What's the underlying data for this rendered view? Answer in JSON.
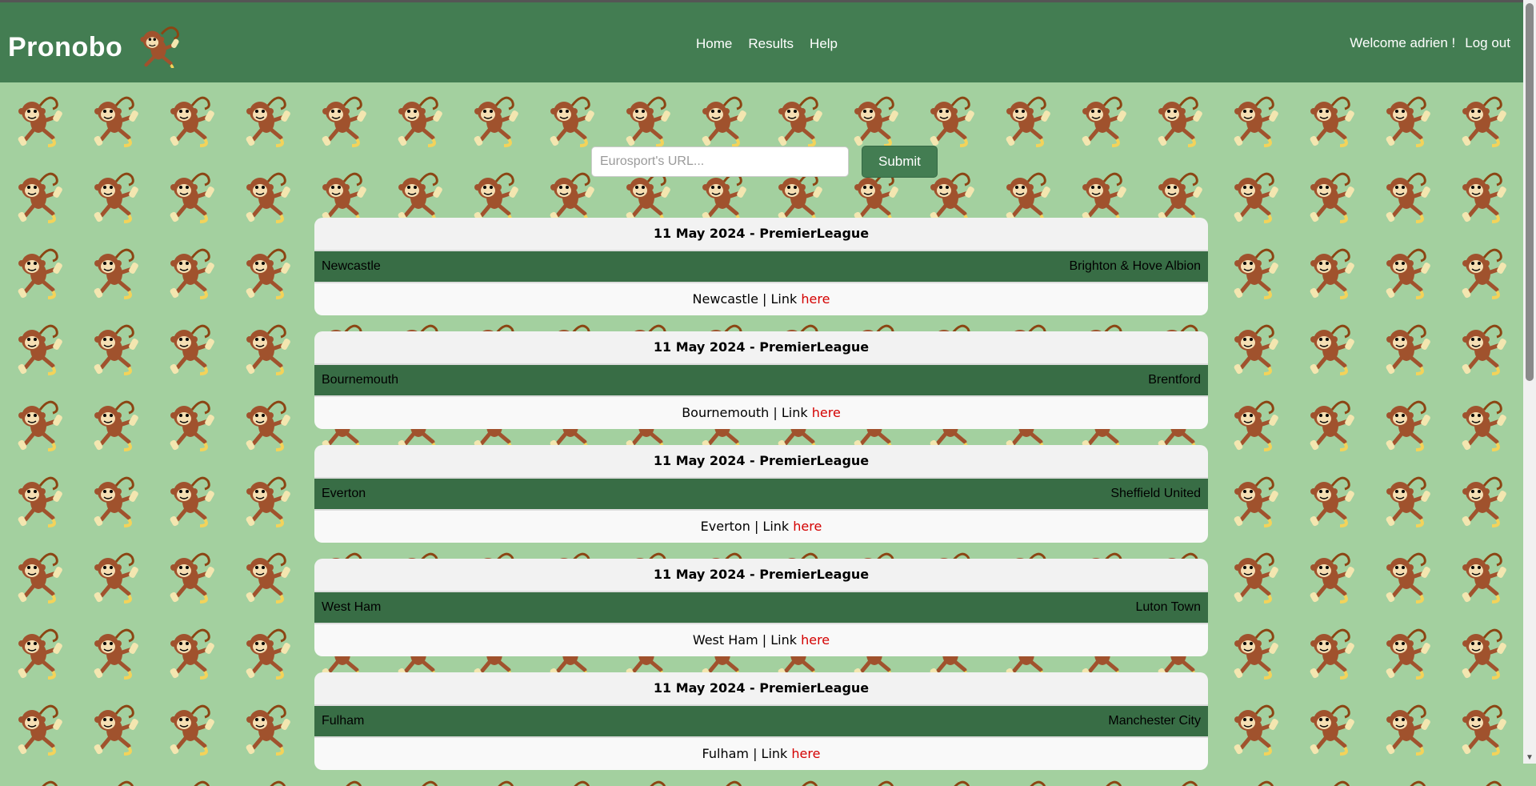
{
  "header": {
    "brand": "Pronobo",
    "nav": [
      {
        "label": "Home"
      },
      {
        "label": "Results"
      },
      {
        "label": "Help"
      }
    ],
    "welcome": "Welcome adrien !",
    "logout": "Log out"
  },
  "search": {
    "placeholder": "Eurosport's URL...",
    "value": "",
    "submit_label": "Submit"
  },
  "matches": [
    {
      "title": "11 May 2024 - PremierLeague",
      "home": "Newcastle",
      "away": "Brighton & Hove Albion",
      "link_prefix": "Newcastle | Link",
      "link_text": "here"
    },
    {
      "title": "11 May 2024 - PremierLeague",
      "home": "Bournemouth",
      "away": "Brentford",
      "link_prefix": "Bournemouth | Link",
      "link_text": "here"
    },
    {
      "title": "11 May 2024 - PremierLeague",
      "home": "Everton",
      "away": "Sheffield United",
      "link_prefix": "Everton | Link",
      "link_text": "here"
    },
    {
      "title": "11 May 2024 - PremierLeague",
      "home": "West Ham",
      "away": "Luton Town",
      "link_prefix": "West Ham | Link",
      "link_text": "here"
    },
    {
      "title": "11 May 2024 - PremierLeague",
      "home": "Fulham",
      "away": "Manchester City",
      "link_prefix": "Fulham | Link",
      "link_text": "here"
    }
  ],
  "colors": {
    "header_bg": "#437d52",
    "page_bg": "#a3d09f",
    "teams_bg": "#386d45",
    "link": "#d40000"
  },
  "icons": {
    "logo": "monkey-logo-icon",
    "background": "monkey-pattern"
  }
}
